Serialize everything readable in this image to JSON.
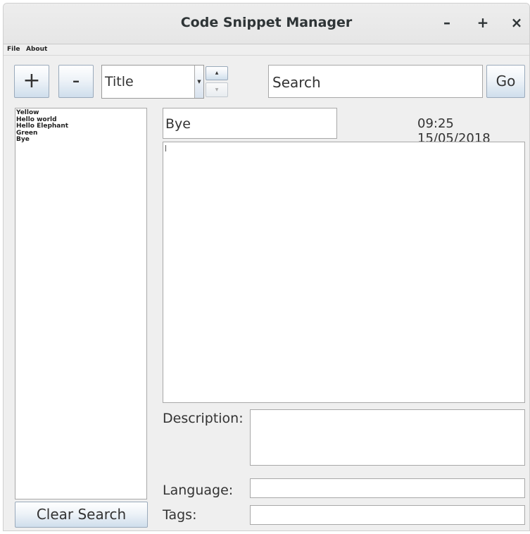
{
  "window": {
    "title": "Code Snippet Manager",
    "minimize_glyph": "–",
    "maximize_glyph": "+",
    "close_glyph": "×"
  },
  "menu": {
    "items": [
      "File",
      "About"
    ]
  },
  "toolbar": {
    "add_label": "+",
    "remove_label": "-",
    "sort_selected": "Title",
    "search_placeholder": "Search",
    "go_label": "Go"
  },
  "snippet_list": {
    "items": [
      "Yellow",
      "Hello world",
      "Hello Elephant",
      "Green",
      "Bye"
    ]
  },
  "clear_search_label": "Clear Search",
  "editor": {
    "title_value": "Bye",
    "timestamp": "09:25 15/05/2018",
    "code_value": "",
    "description_label": "Description:",
    "description_value": "",
    "language_label": "Language:",
    "language_value": "",
    "tags_label": "Tags:",
    "tags_value": ""
  }
}
